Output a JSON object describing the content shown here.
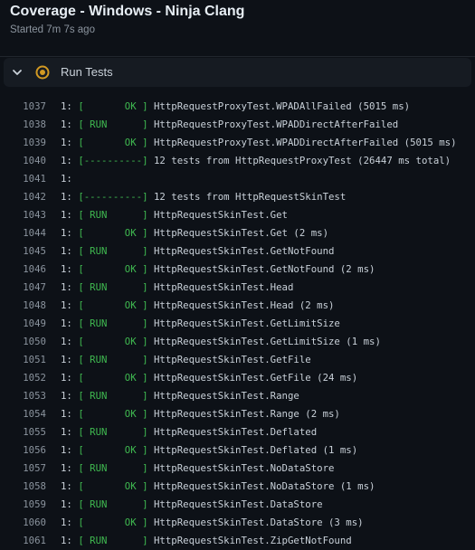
{
  "header": {
    "title": "Coverage - Windows - Ninja Clang",
    "subtitle": "Started 7m 7s ago"
  },
  "step": {
    "label": "Run Tests",
    "expanded_icon": "chevron-down-icon",
    "status_icon": "in-progress-icon",
    "status_color": "#d29922"
  },
  "colors": {
    "background": "#0d1117",
    "step_bar": "#161b22",
    "ok_green": "#3fb950",
    "line_number": "#8b949e"
  },
  "log": [
    {
      "num": "1037",
      "prefix": "1: ",
      "tag": "[       OK ]",
      "msg": " HttpRequestProxyTest.WPADAllFailed (5015 ms)"
    },
    {
      "num": "1038",
      "prefix": "1: ",
      "tag": "[ RUN      ]",
      "msg": " HttpRequestProxyTest.WPADDirectAfterFailed"
    },
    {
      "num": "1039",
      "prefix": "1: ",
      "tag": "[       OK ]",
      "msg": " HttpRequestProxyTest.WPADDirectAfterFailed (5015 ms)"
    },
    {
      "num": "1040",
      "prefix": "1: ",
      "tag": "[----------]",
      "msg": " 12 tests from HttpRequestProxyTest (26447 ms total)"
    },
    {
      "num": "1041",
      "prefix": "1:",
      "tag": "",
      "msg": ""
    },
    {
      "num": "1042",
      "prefix": "1: ",
      "tag": "[----------]",
      "msg": " 12 tests from HttpRequestSkinTest"
    },
    {
      "num": "1043",
      "prefix": "1: ",
      "tag": "[ RUN      ]",
      "msg": " HttpRequestSkinTest.Get"
    },
    {
      "num": "1044",
      "prefix": "1: ",
      "tag": "[       OK ]",
      "msg": " HttpRequestSkinTest.Get (2 ms)"
    },
    {
      "num": "1045",
      "prefix": "1: ",
      "tag": "[ RUN      ]",
      "msg": " HttpRequestSkinTest.GetNotFound"
    },
    {
      "num": "1046",
      "prefix": "1: ",
      "tag": "[       OK ]",
      "msg": " HttpRequestSkinTest.GetNotFound (2 ms)"
    },
    {
      "num": "1047",
      "prefix": "1: ",
      "tag": "[ RUN      ]",
      "msg": " HttpRequestSkinTest.Head"
    },
    {
      "num": "1048",
      "prefix": "1: ",
      "tag": "[       OK ]",
      "msg": " HttpRequestSkinTest.Head (2 ms)"
    },
    {
      "num": "1049",
      "prefix": "1: ",
      "tag": "[ RUN      ]",
      "msg": " HttpRequestSkinTest.GetLimitSize"
    },
    {
      "num": "1050",
      "prefix": "1: ",
      "tag": "[       OK ]",
      "msg": " HttpRequestSkinTest.GetLimitSize (1 ms)"
    },
    {
      "num": "1051",
      "prefix": "1: ",
      "tag": "[ RUN      ]",
      "msg": " HttpRequestSkinTest.GetFile"
    },
    {
      "num": "1052",
      "prefix": "1: ",
      "tag": "[       OK ]",
      "msg": " HttpRequestSkinTest.GetFile (24 ms)"
    },
    {
      "num": "1053",
      "prefix": "1: ",
      "tag": "[ RUN      ]",
      "msg": " HttpRequestSkinTest.Range"
    },
    {
      "num": "1054",
      "prefix": "1: ",
      "tag": "[       OK ]",
      "msg": " HttpRequestSkinTest.Range (2 ms)"
    },
    {
      "num": "1055",
      "prefix": "1: ",
      "tag": "[ RUN      ]",
      "msg": " HttpRequestSkinTest.Deflated"
    },
    {
      "num": "1056",
      "prefix": "1: ",
      "tag": "[       OK ]",
      "msg": " HttpRequestSkinTest.Deflated (1 ms)"
    },
    {
      "num": "1057",
      "prefix": "1: ",
      "tag": "[ RUN      ]",
      "msg": " HttpRequestSkinTest.NoDataStore"
    },
    {
      "num": "1058",
      "prefix": "1: ",
      "tag": "[       OK ]",
      "msg": " HttpRequestSkinTest.NoDataStore (1 ms)"
    },
    {
      "num": "1059",
      "prefix": "1: ",
      "tag": "[ RUN      ]",
      "msg": " HttpRequestSkinTest.DataStore"
    },
    {
      "num": "1060",
      "prefix": "1: ",
      "tag": "[       OK ]",
      "msg": " HttpRequestSkinTest.DataStore (3 ms)"
    },
    {
      "num": "1061",
      "prefix": "1: ",
      "tag": "[ RUN      ]",
      "msg": " HttpRequestSkinTest.ZipGetNotFound"
    }
  ]
}
